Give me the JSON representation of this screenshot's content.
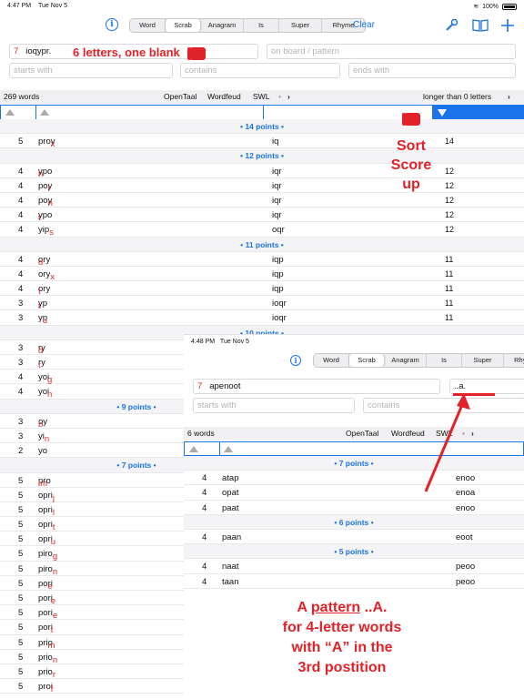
{
  "status": {
    "time": "4:47 PM",
    "date": "Tue Nov 5",
    "battery": "100%"
  },
  "toolbar": {
    "segments": [
      {
        "label": "Word",
        "selected": false
      },
      {
        "label": "Scrab",
        "selected": true
      },
      {
        "label": "Anagram",
        "selected": false
      },
      {
        "label": "Is",
        "selected": false
      },
      {
        "label": "Super",
        "selected": false
      },
      {
        "label": "Rhyme",
        "selected": false
      }
    ],
    "clear": "Clear",
    "icons": [
      "info-icon",
      "wrench-icon",
      "book-icon",
      "plus-icon"
    ],
    "accent": "#1a73e8"
  },
  "inputs": {
    "count": "7",
    "letters": "ioqypr.",
    "pattern_placeholder": "on board / pattern",
    "starts_placeholder": "starts with",
    "contains_placeholder": "contains",
    "ends_placeholder": "ends with"
  },
  "header": {
    "words": "269 words",
    "dict1": "OpenTaal",
    "dict2": "Wordfeud",
    "dict3": "SWL",
    "dots": "•",
    "filter": "longer than 0 letters"
  },
  "groups": [
    {
      "label": "• 14 points •",
      "rows": [
        [
          "5",
          "proxy",
          "iq",
          "14"
        ]
      ]
    },
    {
      "label": "• 12 points •",
      "rows": [
        [
          "4",
          "hypo",
          "iqr",
          "12"
        ],
        [
          "4",
          "poly",
          "iqr",
          "12"
        ],
        [
          "4",
          "pony",
          "iqr",
          "12"
        ],
        [
          "4",
          "typo",
          "iqr",
          "12"
        ],
        [
          "4",
          "yips",
          "oqr",
          "12"
        ]
      ]
    },
    {
      "label": "• 11 points •",
      "rows": [
        [
          "4",
          "dory",
          "iqp",
          "11"
        ],
        [
          "4",
          "oryx",
          "iqp",
          "11"
        ],
        [
          "4",
          "tory",
          "iqp",
          "11"
        ],
        [
          "3",
          "typ",
          "ioqr",
          "11"
        ],
        [
          "3",
          "yup",
          "ioqr",
          "11"
        ]
      ]
    },
    {
      "label": "• 10 points •",
      "rows": [
        [
          "3",
          "dry",
          "",
          ""
        ],
        [
          "3",
          "try",
          "",
          ""
        ],
        [
          "4",
          "yogi",
          "",
          ""
        ],
        [
          "4",
          "yoni",
          "",
          ""
        ]
      ]
    },
    {
      "label": "• 9 points •",
      "rows": [
        [
          "3",
          "boy",
          "",
          ""
        ],
        [
          "3",
          "yin",
          "",
          ""
        ],
        [
          "2",
          "yo",
          "",
          ""
        ]
      ]
    },
    {
      "label": "• 7 points •",
      "rows": [
        [
          "5",
          "impro",
          "",
          ""
        ],
        [
          "5",
          "oprij",
          "",
          ""
        ],
        [
          "5",
          "opril",
          "",
          ""
        ],
        [
          "5",
          "oprit",
          "",
          ""
        ],
        [
          "5",
          "oprui",
          "",
          ""
        ],
        [
          "5",
          "pirog",
          "",
          ""
        ],
        [
          "5",
          "piron",
          "",
          ""
        ],
        [
          "5",
          "poeri",
          "",
          ""
        ],
        [
          "5",
          "porei",
          "",
          ""
        ],
        [
          "5",
          "porie",
          "",
          ""
        ],
        [
          "5",
          "porti",
          "",
          ""
        ],
        [
          "5",
          "primo",
          "",
          ""
        ],
        [
          "5",
          "prion",
          "",
          ""
        ],
        [
          "5",
          "prior",
          "",
          ""
        ],
        [
          "5",
          "profi",
          "",
          ""
        ]
      ]
    }
  ],
  "inset": {
    "time": "4:48 PM",
    "date": "Tue Nov 5",
    "count": "7",
    "letters": "apenoot",
    "pattern": "..a.",
    "starts_placeholder": "starts with",
    "contains_placeholder": "contains",
    "words": "6 words",
    "dict1": "OpenTaal",
    "dict2": "Wordfeud",
    "dict3": "SWL",
    "segments": [
      "Word",
      "Scrab",
      "Anagram",
      "Is",
      "Super",
      "Rhyme"
    ],
    "groups": [
      {
        "label": "• 7 points •",
        "rows": [
          [
            "4",
            "atap",
            "enoo"
          ],
          [
            "4",
            "opat",
            "enoa"
          ],
          [
            "4",
            "paat",
            "enoo"
          ]
        ]
      },
      {
        "label": "• 6 points •",
        "rows": [
          [
            "4",
            "paan",
            "eoot"
          ]
        ]
      },
      {
        "label": "• 5 points •",
        "rows": [
          [
            "4",
            "naat",
            "peoo"
          ],
          [
            "4",
            "taan",
            "peoo"
          ]
        ]
      }
    ]
  },
  "annotations": {
    "six_letters": "6 letters, one blank",
    "sort_score": [
      "Sort",
      "Score",
      "up"
    ],
    "pattern_note_prefix": "A ",
    "pattern_word": "pattern",
    "pattern_note_suffix": " ..A.",
    "pattern_lines": [
      "for 4-letter words",
      "with “A” in the",
      "3rd postition"
    ],
    "color": "#e22229"
  }
}
